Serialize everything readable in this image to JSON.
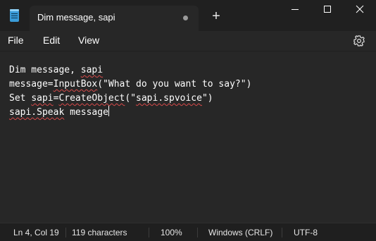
{
  "app": {
    "tab_title": "Dim message, sapi",
    "new_tab_symbol": "+"
  },
  "menu": {
    "file": "File",
    "edit": "Edit",
    "view": "View"
  },
  "editor": {
    "lines": [
      {
        "segments": [
          {
            "text": "Dim message, ",
            "misspelled": false
          },
          {
            "text": "sapi",
            "misspelled": true
          }
        ]
      },
      {
        "segments": [
          {
            "text": "message=",
            "misspelled": false
          },
          {
            "text": "InputBox",
            "misspelled": true
          },
          {
            "text": "(\"What do you want to say?\")",
            "misspelled": false
          }
        ]
      },
      {
        "segments": [
          {
            "text": "Set ",
            "misspelled": false
          },
          {
            "text": "sapi",
            "misspelled": true
          },
          {
            "text": "=",
            "misspelled": false
          },
          {
            "text": "CreateObject",
            "misspelled": true
          },
          {
            "text": "(\"",
            "misspelled": false
          },
          {
            "text": "sapi.spvoice",
            "misspelled": true
          },
          {
            "text": "\")",
            "misspelled": false
          }
        ]
      },
      {
        "segments": [
          {
            "text": "sapi.Speak",
            "misspelled": true
          },
          {
            "text": " message",
            "misspelled": false
          }
        ]
      }
    ]
  },
  "status": {
    "position": "Ln 4, Col 19",
    "characters": "119 characters",
    "zoom": "100%",
    "line_ending": "Windows (CRLF)",
    "encoding": "UTF-8"
  },
  "icons": {
    "app": "notepad-icon",
    "modified": "unsaved-dot-icon",
    "settings": "gear-icon",
    "minimize": "minimize-icon",
    "maximize": "maximize-icon",
    "close": "close-icon"
  },
  "colors": {
    "background": "#272727",
    "titlebar": "#202020",
    "statusbar": "#1f1f1f",
    "text": "#ffffff",
    "spell_squiggle": "#d94a4a",
    "app_icon": "#3a9bd8"
  }
}
